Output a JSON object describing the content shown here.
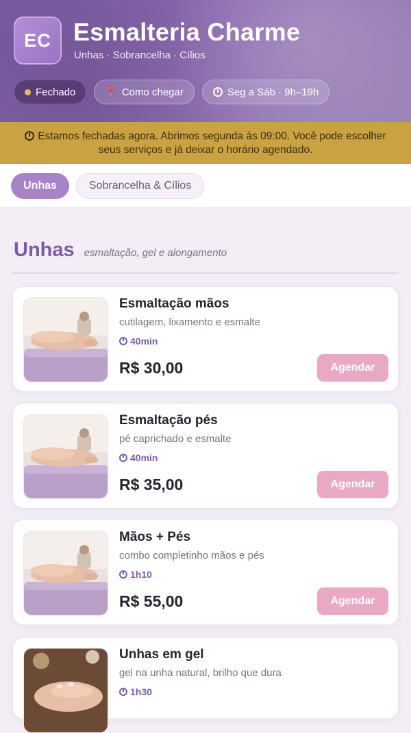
{
  "header": {
    "logo_initials": "EC",
    "title": "Esmalteria Charme",
    "subtitle": "Unhas · Sobrancelha · Cílios",
    "status_label": "Fechado",
    "directions_label": "Como chegar",
    "hours_label": "Seg a Sáb · 9h–19h"
  },
  "notice": {
    "text": "Estamos fechadas agora. Abrimos segunda às 09:00. Você pode escolher seus serviços e já deixar o horário agendado."
  },
  "tabs": [
    {
      "label": "Unhas",
      "active": true
    },
    {
      "label": "Sobrancelha & Cílios",
      "active": false
    }
  ],
  "section": {
    "title": "Unhas",
    "subtitle": "esmaltação, gel e alongamento"
  },
  "services": [
    {
      "name": "Esmaltação mãos",
      "description": "cutilagem, lixamento e esmalte",
      "duration": "40min",
      "price": "R$ 30,00",
      "button": "Agendar"
    },
    {
      "name": "Esmaltação pés",
      "description": "pé caprichado e esmalte",
      "duration": "40min",
      "price": "R$ 35,00",
      "button": "Agendar"
    },
    {
      "name": "Mãos + Pés",
      "description": "combo completinho mãos e pés",
      "duration": "1h10",
      "price": "R$ 55,00",
      "button": "Agendar"
    },
    {
      "name": "Unhas em gel",
      "description": "gel na unha natural, brilho que dura",
      "duration": "1h30",
      "price": "",
      "button": ""
    }
  ],
  "colors": {
    "accent": "#7d5ba6",
    "notice_bg": "#c9a342",
    "button": "#e9a9c4"
  }
}
